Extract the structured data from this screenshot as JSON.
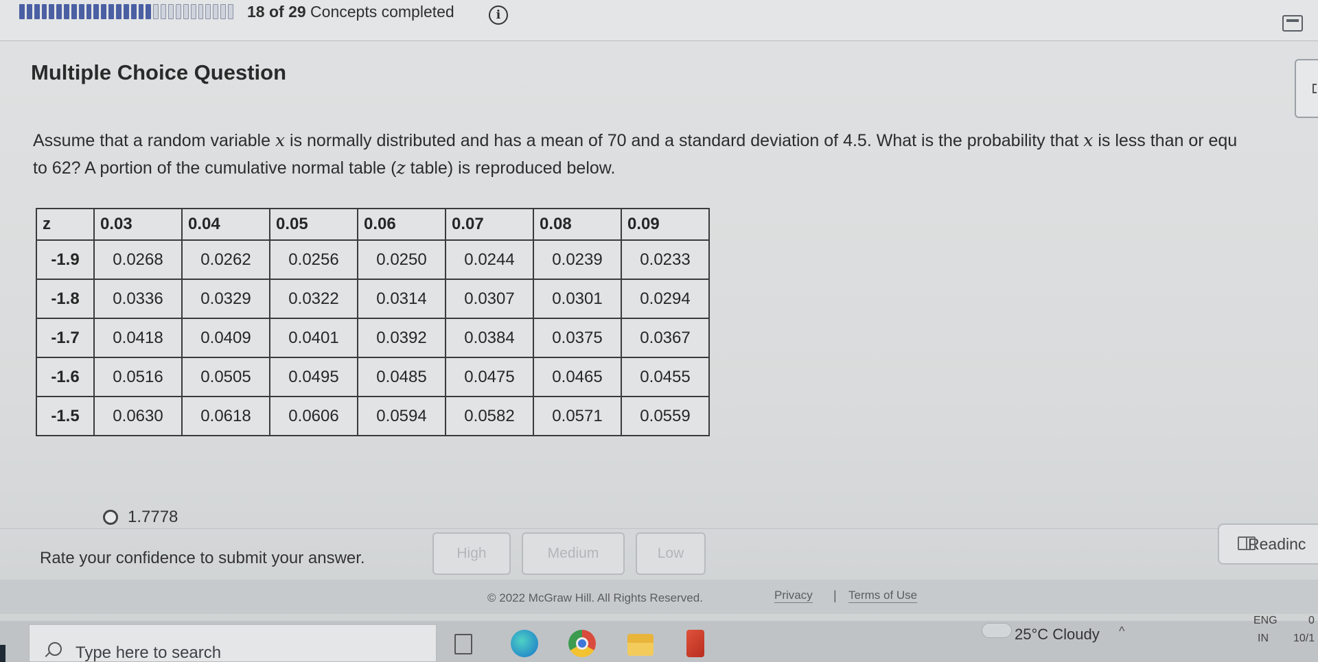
{
  "header": {
    "progress_bold": "18 of 29",
    "progress_rest": " Concepts completed",
    "progress": {
      "completed": 18,
      "total": 29
    },
    "info_glyph": "i",
    "icons": [
      "info-icon",
      "calculator-icon"
    ]
  },
  "question": {
    "label": "Multiple Choice Question",
    "text_part1": "Assume that a random variable ",
    "var1": "x",
    "text_part2": " is normally distributed and has a mean of 70 and a standard deviation of 4.5. What is the probability that ",
    "var2": "x",
    "text_part3": " is less than or equ",
    "text_line2_a": "to 62? A portion of the cumulative normal table (",
    "var3": "z",
    "text_line2_b": " table) is reproduced below."
  },
  "ztable": {
    "headers": [
      "z",
      "0.03",
      "0.04",
      "0.05",
      "0.06",
      "0.07",
      "0.08",
      "0.09"
    ],
    "rows": [
      [
        "-1.9",
        "0.0268",
        "0.0262",
        "0.0256",
        "0.0250",
        "0.0244",
        "0.0239",
        "0.0233"
      ],
      [
        "-1.8",
        "0.0336",
        "0.0329",
        "0.0322",
        "0.0314",
        "0.0307",
        "0.0301",
        "0.0294"
      ],
      [
        "-1.7",
        "0.0418",
        "0.0409",
        "0.0401",
        "0.0392",
        "0.0384",
        "0.0375",
        "0.0367"
      ],
      [
        "-1.6",
        "0.0516",
        "0.0505",
        "0.0495",
        "0.0485",
        "0.0475",
        "0.0465",
        "0.0455"
      ],
      [
        "-1.5",
        "0.0630",
        "0.0618",
        "0.0606",
        "0.0594",
        "0.0582",
        "0.0571",
        "0.0559"
      ]
    ]
  },
  "answers": [
    {
      "label": "1.7778",
      "selected": false
    }
  ],
  "confidence": {
    "prompt": "Rate your confidence to submit your answer.",
    "high": "High",
    "medium": "Medium",
    "low": "Low"
  },
  "reading": {
    "label": "Readinc"
  },
  "footer": {
    "copyright": "© 2022 McGraw Hill. All Rights Reserved.",
    "privacy": "Privacy",
    "separator": "|",
    "terms": "Terms of Use"
  },
  "taskbar": {
    "search_placeholder": "Type here to search",
    "weather": "25°C  Cloudy",
    "lang_top": "ENG",
    "lang_bottom": "IN",
    "time_fragment": "0",
    "date_fragment": "10/1",
    "tray_chevron": "^"
  },
  "colors": {
    "progress_done": "#4b5fa3",
    "background": "#dfe1e2",
    "text": "#2b2b2b"
  }
}
